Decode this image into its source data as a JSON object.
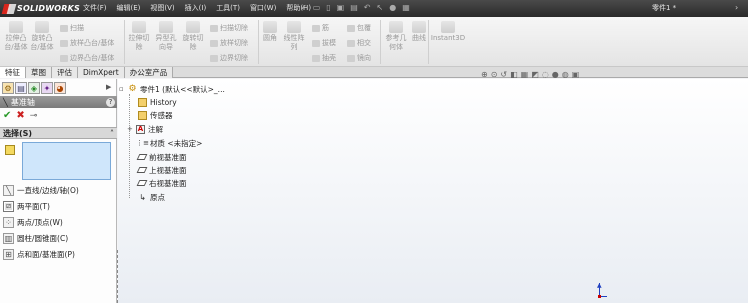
{
  "app": {
    "logo_text": "SOLIDWORKS",
    "document_title": "零件1 *"
  },
  "menu": [
    "文件(F)",
    "编辑(E)",
    "视图(V)",
    "插入(I)",
    "工具(T)",
    "窗口(W)",
    "帮助(H)"
  ],
  "command_manager": {
    "extrude_boss": "拉伸凸台/基体",
    "revolve_boss": "旋转凸台/基体",
    "sweep": "扫描",
    "loft_boss": "放样凸台/基体",
    "boundary_boss": "边界凸台/基体",
    "extrude_cut": "拉伸切除",
    "hole_wizard": "异型孔向导",
    "revolve_cut": "旋转切除",
    "swept_cut": "扫描切除",
    "lofted_cut": "放样切除",
    "boundary_cut": "边界切除",
    "fillet": "圆角",
    "linear_pattern": "线性阵列",
    "rib": "筋",
    "draft": "拔模",
    "shell": "抽壳",
    "wrap": "包覆",
    "intersect": "相交",
    "mirror": "镜向",
    "reference_geometry": "参考几何体",
    "curves": "曲线",
    "instant3d": "Instant3D"
  },
  "tabs": [
    "特征",
    "草图",
    "评估",
    "DimXpert",
    "办公室产品"
  ],
  "property_manager": {
    "title": "基准轴",
    "help": "?",
    "selection_header": "选择(S)",
    "options": [
      {
        "label": "一直线/边线/轴(O)",
        "icon": "line-icon"
      },
      {
        "label": "两平面(T)",
        "icon": "two-planes-icon",
        "selected": true
      },
      {
        "label": "两点/顶点(W)",
        "icon": "two-points-icon"
      },
      {
        "label": "圆柱/圆锥面(C)",
        "icon": "cylinder-icon"
      },
      {
        "label": "点和面/基准面(P)",
        "icon": "point-face-icon"
      }
    ]
  },
  "feature_tree": {
    "root": "零件1 (默认<<默认>_...",
    "items": [
      {
        "label": "History",
        "icon": "folder-icon"
      },
      {
        "label": "传感器",
        "icon": "sensor-icon"
      },
      {
        "label": "注解",
        "icon": "annotation-icon",
        "expandable": true
      },
      {
        "label": "材质 <未指定>",
        "icon": "material-icon"
      },
      {
        "label": "前视基准面",
        "icon": "plane-icon"
      },
      {
        "label": "上视基准面",
        "icon": "plane-icon"
      },
      {
        "label": "右视基准面",
        "icon": "plane-icon"
      },
      {
        "label": "原点",
        "icon": "origin-icon"
      }
    ]
  }
}
